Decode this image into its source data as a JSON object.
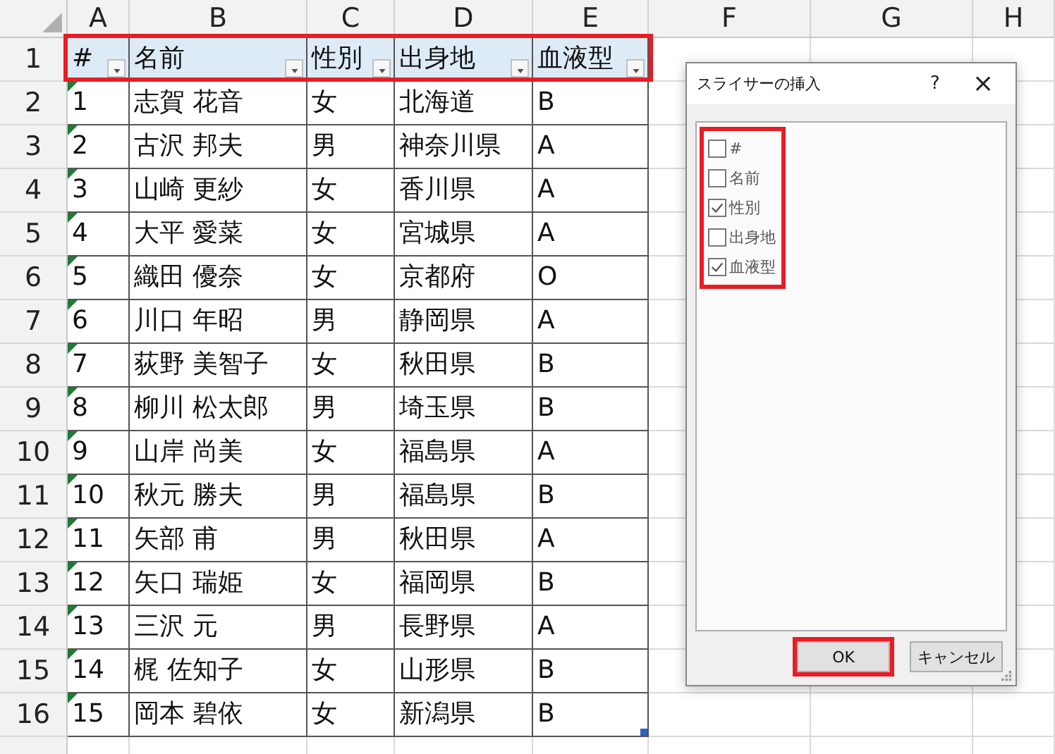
{
  "sheet": {
    "column_headers": [
      "A",
      "B",
      "C",
      "D",
      "E",
      "F",
      "G",
      "H"
    ],
    "row_headers": [
      "1",
      "2",
      "3",
      "4",
      "5",
      "6",
      "7",
      "8",
      "9",
      "10",
      "11",
      "12",
      "13",
      "14",
      "15",
      "16"
    ],
    "table": {
      "highlight": true,
      "columns": [
        "#",
        "名前",
        "性別",
        "出身地",
        "血液型"
      ],
      "rows": [
        {
          "cells": [
            "1",
            "志賀 花音",
            "女",
            "北海道",
            "B"
          ],
          "flag": true
        },
        {
          "cells": [
            "2",
            "古沢 邦夫",
            "男",
            "神奈川県",
            "A"
          ],
          "flag": true
        },
        {
          "cells": [
            "3",
            "山崎 更紗",
            "女",
            "香川県",
            "A"
          ],
          "flag": true
        },
        {
          "cells": [
            "4",
            "大平 愛菜",
            "女",
            "宮城県",
            "A"
          ],
          "flag": true
        },
        {
          "cells": [
            "5",
            "織田 優奈",
            "女",
            "京都府",
            "O"
          ],
          "flag": true
        },
        {
          "cells": [
            "6",
            "川口 年昭",
            "男",
            "静岡県",
            "A"
          ],
          "flag": true
        },
        {
          "cells": [
            "7",
            "荻野 美智子",
            "女",
            "秋田県",
            "B"
          ],
          "flag": true
        },
        {
          "cells": [
            "8",
            "柳川 松太郎",
            "男",
            "埼玉県",
            "B"
          ],
          "flag": true
        },
        {
          "cells": [
            "9",
            "山岸 尚美",
            "女",
            "福島県",
            "A"
          ],
          "flag": true
        },
        {
          "cells": [
            "10",
            "秋元 勝夫",
            "男",
            "福島県",
            "B"
          ],
          "flag": true
        },
        {
          "cells": [
            "11",
            "矢部 甫",
            "男",
            "秋田県",
            "A"
          ],
          "flag": true
        },
        {
          "cells": [
            "12",
            "矢口 瑞姫",
            "女",
            "福岡県",
            "B"
          ],
          "flag": true
        },
        {
          "cells": [
            "13",
            "三沢 元",
            "男",
            "長野県",
            "A"
          ],
          "flag": true
        },
        {
          "cells": [
            "14",
            "梶 佐知子",
            "女",
            "山形県",
            "B"
          ],
          "flag": true
        },
        {
          "cells": [
            "15",
            "岡本 碧依",
            "女",
            "新潟県",
            "B"
          ],
          "flag": true
        }
      ]
    }
  },
  "dialog": {
    "title": "スライサーの挿入",
    "help": "?",
    "close": "×",
    "fields": {
      "highlight": true,
      "items": [
        {
          "label": "#",
          "checked": false
        },
        {
          "label": "名前",
          "checked": false
        },
        {
          "label": "性別",
          "checked": true
        },
        {
          "label": "出身地",
          "checked": false
        },
        {
          "label": "血液型",
          "checked": true
        }
      ]
    },
    "buttons": [
      {
        "label": "OK",
        "highlight": true
      },
      {
        "label": "キャンセル",
        "highlight": false
      }
    ]
  }
}
